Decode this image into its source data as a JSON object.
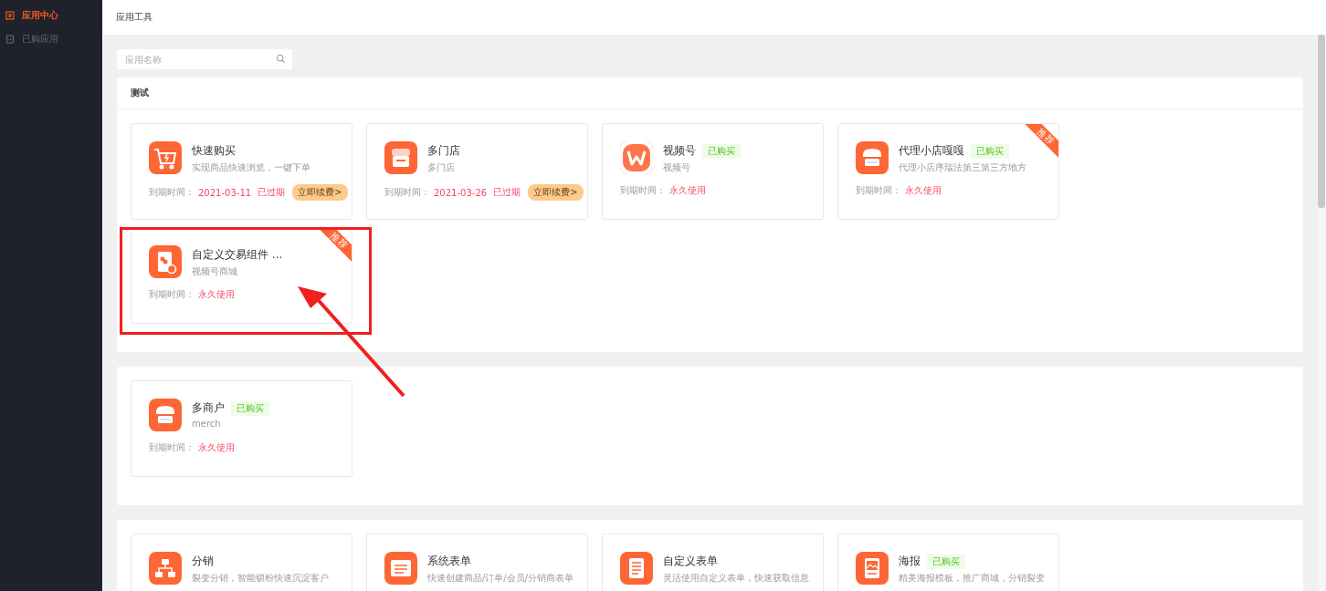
{
  "sidebar": {
    "items": [
      {
        "label": "应用中心",
        "selected": true,
        "kind": "grid"
      },
      {
        "label": "已购应用",
        "selected": false,
        "kind": "doc"
      }
    ]
  },
  "header": {
    "title": "应用工具"
  },
  "search": {
    "placeholder": "应用名称"
  },
  "sections": [
    {
      "title": "测试",
      "cards": [
        {
          "kind": "cart",
          "name": "快速购买",
          "desc": "实现商品快速浏览，一键下单",
          "expire_label": "到期时间：",
          "expire_value": "2021-03-11",
          "status": "已过期",
          "renew": "立即续费>"
        },
        {
          "kind": "store",
          "name": "多门店",
          "desc": "多门店",
          "expire_label": "到期时间：",
          "expire_value": "2021-03-26",
          "status": "已过期",
          "renew": "立即续费>"
        },
        {
          "kind": "video",
          "name": "视频号",
          "badge": "已购买",
          "desc": "视频号",
          "expire_label": "到期时间：",
          "expire_value": "永久使用"
        },
        {
          "kind": "shop",
          "name": "代理小店嘎嘎",
          "badge": "已购买",
          "desc": "代理小店序瑞法第三第三方地方",
          "expire_label": "到期时间：",
          "expire_value": "永久使用",
          "ribbon": "推荐"
        },
        {
          "kind": "phone",
          "name": "自定义交易组件 ...",
          "desc": "视频号商城",
          "expire_label": "到期时间：",
          "expire_value": "永久使用",
          "ribbon": "推荐"
        }
      ]
    },
    {
      "cards": [
        {
          "kind": "shop",
          "name": "多商户",
          "badge": "已购买",
          "desc": "merch",
          "expire_label": "到期时间：",
          "expire_value": "永久使用"
        }
      ]
    },
    {
      "cards": [
        {
          "kind": "org",
          "name": "分销",
          "desc": "裂变分销，智能锁粉快速沉淀客户"
        },
        {
          "kind": "form",
          "name": "系统表单",
          "desc": "快速创建商品/订单/会员/分销商表单"
        },
        {
          "kind": "doc",
          "name": "自定义表单",
          "desc": "灵活使用自定义表单，快速获取信息"
        },
        {
          "kind": "poster",
          "name": "海报",
          "badge": "已购买",
          "desc": "精美海报模板，推广商城，分销裂变"
        }
      ]
    }
  ]
}
